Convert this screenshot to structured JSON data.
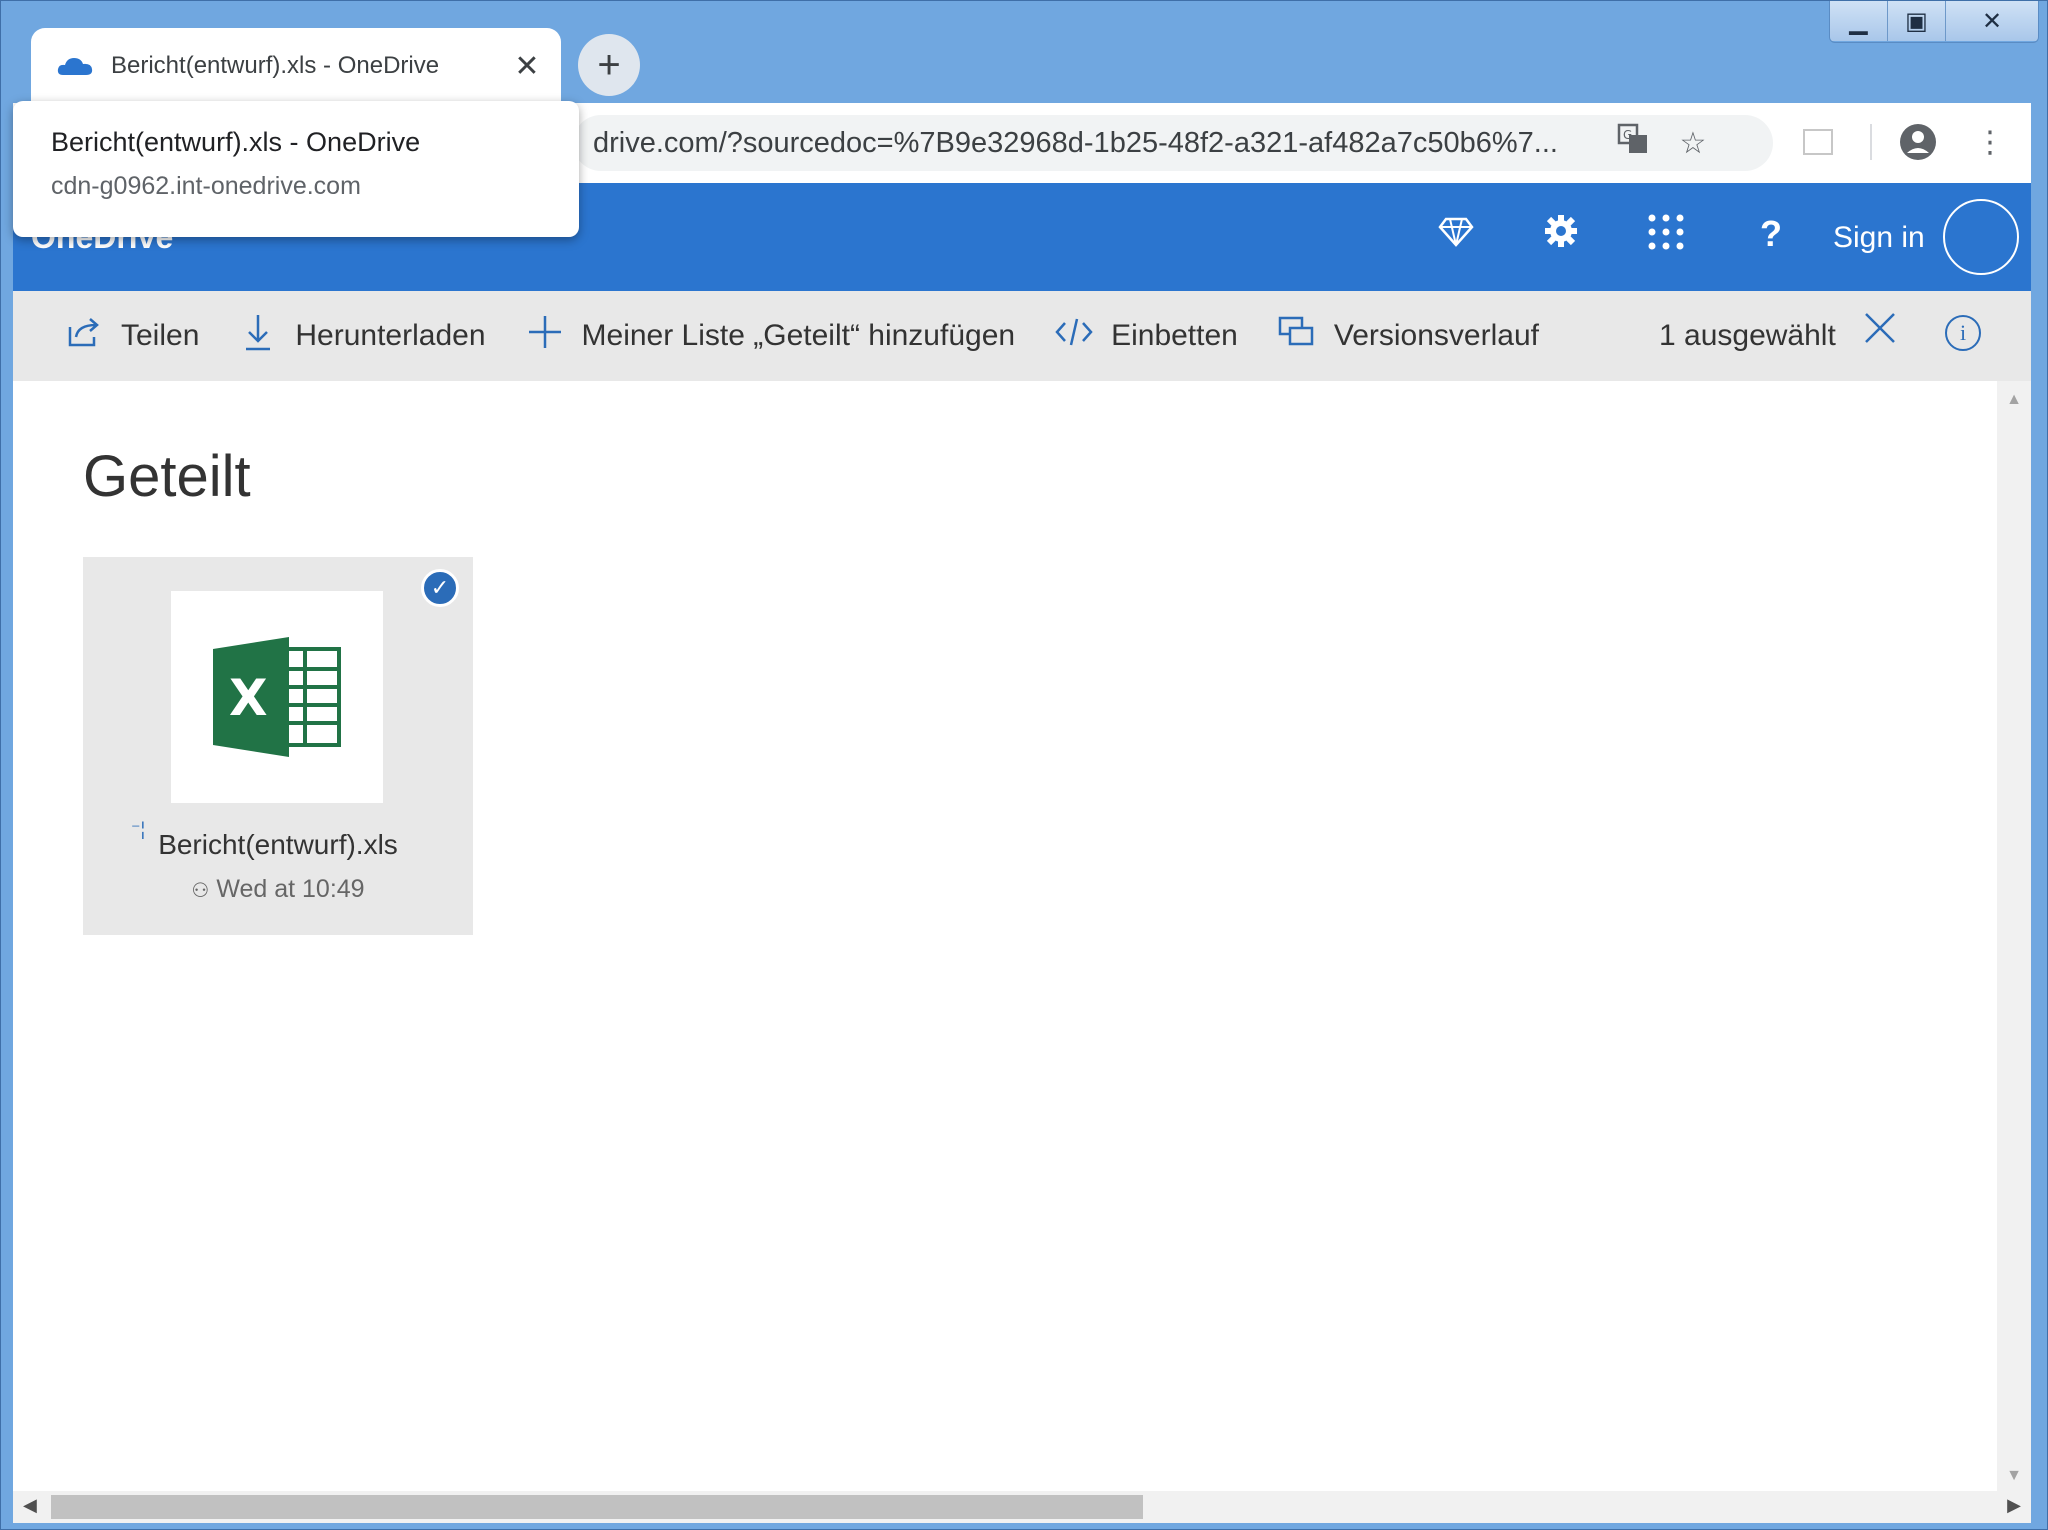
{
  "browser": {
    "tab_title": "Bericht(entwurf).xls - OneDrive",
    "tab_close": "✕",
    "new_tab": "+",
    "url": "drive.com/?sourcedoc=%7B9e32968d-1b25-48f2-a321-af482a7c50b6%7...",
    "window_controls": {
      "minimize": "▁",
      "maximize": "▣",
      "close": "✕"
    }
  },
  "popup": {
    "title": "Bericht(entwurf).xls - OneDrive",
    "url": "cdn-g0962.int-onedrive.com"
  },
  "app": {
    "brand": "OneDrive",
    "sign_in": "Sign in",
    "icons": {
      "premium": "diamond-icon",
      "settings": "gear-icon",
      "apps": "app-launcher-icon",
      "help": "help-icon"
    }
  },
  "commands": {
    "share": "Teilen",
    "download": "Herunterladen",
    "add_to_shared": "Meiner Liste „Geteilt“ hinzufügen",
    "embed": "Einbetten",
    "version_history": "Versionsverlauf",
    "selected_count": "1 ausgewählt"
  },
  "content": {
    "heading": "Geteilt",
    "files": [
      {
        "name": "Bericht(entwurf).xls",
        "modified": "Wed at 10:49",
        "selected": true,
        "type": "excel"
      }
    ]
  },
  "colors": {
    "accent": "#2b75cf",
    "excel_green": "#217346",
    "command_icon": "#2b6cb8"
  }
}
